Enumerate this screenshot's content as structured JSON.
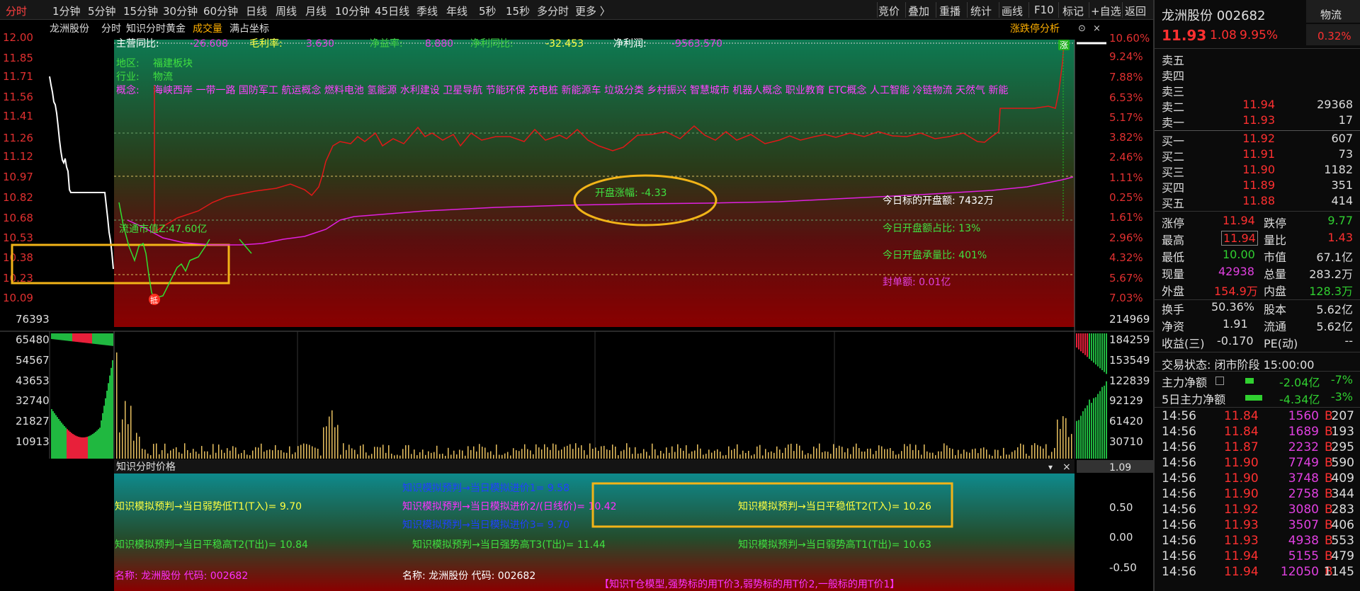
{
  "periods": [
    "分时",
    "1分钟",
    "5分钟",
    "15分钟",
    "30分钟",
    "60分钟",
    "日线",
    "周线",
    "月线",
    "10分钟",
    "45日线",
    "季线",
    "年线",
    "5秒",
    "15秒",
    "多分时",
    "更多 〉"
  ],
  "tools": [
    "竞价",
    "叠加",
    "重播",
    "统计",
    "画线",
    "F10",
    "标记",
    "+自选",
    "返回"
  ],
  "chart_header": {
    "stock": "龙洲股份",
    "fenshi": "分时",
    "indicator": "知识分时黄金",
    "chengjiao": "成交量",
    "mantian": "满占坐标",
    "zhangting_analysis": "涨跌停分析",
    "close_mark": "×",
    "down_icon": "▾",
    "xi_icon": "⊙"
  },
  "fin": {
    "l1": "主营同比:",
    "v1": "-26.608",
    "l2": "毛利率:",
    "v2": "3.630",
    "l3": "净益率:",
    "v3": "8.880",
    "l4": "净利同比:",
    "v4": "-32.453",
    "l5": "净利润:",
    "v5": "-9563.570"
  },
  "info": {
    "region_label": "地区:",
    "region": "福建板块",
    "industry_label": "行业:",
    "industry": "物流",
    "concept_label": "概念:",
    "concepts": "海峡西岸 一带一路 国防军工 航运概念 燃料电池 氢能源 水利建设 卫星导航 节能环保 充电桩 新能源车 垃圾分类 乡村振兴 智慧城市 机器人概念 职业教育 ETC概念 人工智能 冷链物流 天然气 新能"
  },
  "annot": {
    "kaipan_zhangfu": "开盘涨幅: -4.33",
    "kaipan_e": "今日标的开盘额: 7432万",
    "kaipan_zhanbi": "今日开盘额占比: 13%",
    "kaipan_chengliang": "今日开盘承量比: 401%",
    "fengdan": "封单额: 0.01亿",
    "liutong_sz": "流通市值Z:47.60亿",
    "zhang_mark": "涨",
    "di_mark": "抵"
  },
  "left_axis": [
    "12.00",
    "11.85",
    "11.71",
    "11.56",
    "11.41",
    "11.26",
    "11.12",
    "10.97",
    "10.82",
    "10.68",
    "10.53",
    "10.38",
    "10.23",
    "10.09"
  ],
  "right_axis": [
    "10.60%",
    "9.24%",
    "7.88%",
    "6.53%",
    "5.17%",
    "3.82%",
    "2.46%",
    "1.11%",
    "0.25%",
    "1.61%",
    "2.96%",
    "4.32%",
    "5.67%",
    "7.03%"
  ],
  "vol_left": [
    "76393",
    "65480",
    "54567",
    "43653",
    "32740",
    "21827",
    "10913"
  ],
  "vol_right": [
    "214969",
    "184259",
    "153549",
    "122839",
    "92129",
    "61420",
    "30710"
  ],
  "panel": {
    "title": "知识分时价格",
    "ratio": "1.09",
    "axis": [
      "0.50",
      "0.00",
      "-0.50"
    ],
    "jinjia1": "知识模拟预判→当日模拟进价1= 9.58",
    "ruoshi_di": "知识模拟预判→当日弱势低T1(T入)= 9.70",
    "jinjia2": "知识模拟预判→当日模拟进价2/(日线价)= 10.42",
    "pingwen_di": "知识模拟预判→当日平稳低T2(T入)= 10.26",
    "jinjia3": "知识模拟预判→当日模拟进价3= 9.70",
    "pingwen_gao": "知识模拟预判→当日平稳高T2(T出)= 10.84",
    "qiangshi_gao": "知识模拟预判→当日强势高T3(T出)= 11.44",
    "ruoshi_gao": "知识模拟预判→当日弱势高T1(T出)= 10.63",
    "name1": "名称: 龙洲股份 代码: 002682",
    "name2": "名称: 龙洲股份 代码: 002682",
    "footer": "【知识T仓模型,强势标的用T价3,弱势标的用T价2,一般标的用T价1】"
  },
  "quote": {
    "name": "龙洲股份 002682",
    "sector": "物流",
    "sector_pct": "0.32%",
    "price": "11.93",
    "change": "1.08",
    "pct": "9.95%",
    "sells": [
      {
        "l": "卖五",
        "p": "",
        "v": ""
      },
      {
        "l": "卖四",
        "p": "",
        "v": ""
      },
      {
        "l": "卖三",
        "p": "",
        "v": ""
      },
      {
        "l": "卖二",
        "p": "11.94",
        "v": "29368"
      },
      {
        "l": "卖一",
        "p": "11.93",
        "v": "17"
      }
    ],
    "buys": [
      {
        "l": "买一",
        "p": "11.92",
        "v": "607"
      },
      {
        "l": "买二",
        "p": "11.91",
        "v": "73"
      },
      {
        "l": "买三",
        "p": "11.90",
        "v": "1182"
      },
      {
        "l": "买四",
        "p": "11.89",
        "v": "351"
      },
      {
        "l": "买五",
        "p": "11.88",
        "v": "414"
      }
    ]
  },
  "stats": {
    "zt_l": "涨停",
    "zt": "11.94",
    "dt_l": "跌停",
    "dt": "9.77",
    "zg_l": "最高",
    "zg": "11.94",
    "lb_l": "量比",
    "lb": "1.43",
    "zd_l": "最低",
    "zd": "10.00",
    "sz_l": "市值",
    "sz": "67.1亿",
    "xl_l": "现量",
    "xl": "42938",
    "zl_l": "总量",
    "zl": "283.2万",
    "wp_l": "外盘",
    "wp": "154.9万",
    "np_l": "内盘",
    "np": "128.3万",
    "hs_l": "换手",
    "hs": "50.36%",
    "gb_l": "股本",
    "gb": "5.62亿",
    "jz_l": "净资",
    "jz": "1.91",
    "lt_l": "流通",
    "lt": "5.62亿",
    "sy_l": "收益(三)",
    "sy": "-0.170",
    "pe_l": "PE(动)",
    "pe": "--"
  },
  "status": {
    "text": "交易状态: 闭市阶段 15:00:00",
    "zl_l": "主力净额",
    "zl_v": "-2.04亿",
    "zl_p": "-7%",
    "wr_l": "5日主力净额",
    "wr_v": "-4.34亿",
    "wr_p": "-3%"
  },
  "ticks": [
    {
      "t": "14:56",
      "p": "11.84",
      "v": "1560",
      "d": "B",
      "n": "207"
    },
    {
      "t": "14:56",
      "p": "11.84",
      "v": "1689",
      "d": "B",
      "n": "193"
    },
    {
      "t": "14:56",
      "p": "11.87",
      "v": "2232",
      "d": "B",
      "n": "295"
    },
    {
      "t": "14:56",
      "p": "11.90",
      "v": "7749",
      "d": "B",
      "n": "590"
    },
    {
      "t": "14:56",
      "p": "11.90",
      "v": "3748",
      "d": "B",
      "n": "409"
    },
    {
      "t": "14:56",
      "p": "11.90",
      "v": "2758",
      "d": "B",
      "n": "344"
    },
    {
      "t": "14:56",
      "p": "11.92",
      "v": "3080",
      "d": "B",
      "n": "283"
    },
    {
      "t": "14:56",
      "p": "11.93",
      "v": "3507",
      "d": "B",
      "n": "406"
    },
    {
      "t": "14:56",
      "p": "11.93",
      "v": "4938",
      "d": "B",
      "n": "553"
    },
    {
      "t": "14:56",
      "p": "11.94",
      "v": "5155",
      "d": "B",
      "n": "479"
    },
    {
      "t": "14:56",
      "p": "11.94",
      "v": "12050",
      "d": "B",
      "n": "1145"
    }
  ]
}
